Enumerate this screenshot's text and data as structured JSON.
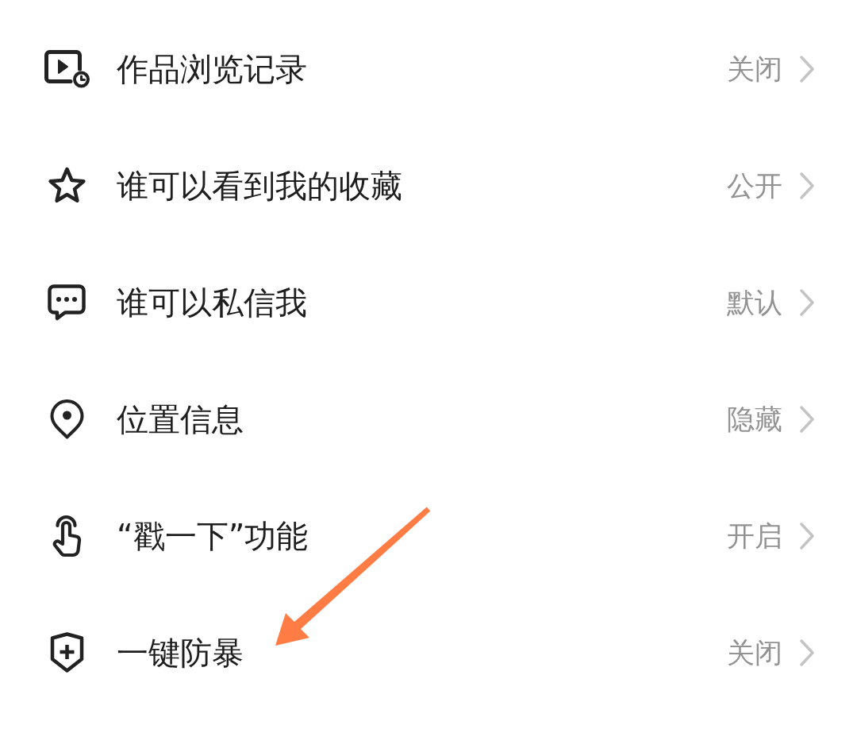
{
  "items": [
    {
      "label": "作品浏览记录",
      "value": "关闭"
    },
    {
      "label": "谁可以看到我的收藏",
      "value": "公开"
    },
    {
      "label": "谁可以私信我",
      "value": "默认"
    },
    {
      "label": "位置信息",
      "value": "隐藏"
    },
    {
      "label": "“戳一下”功能",
      "value": "开启"
    },
    {
      "label": "一键防暴",
      "value": "关闭"
    }
  ],
  "annotation": {
    "kind": "arrow"
  }
}
